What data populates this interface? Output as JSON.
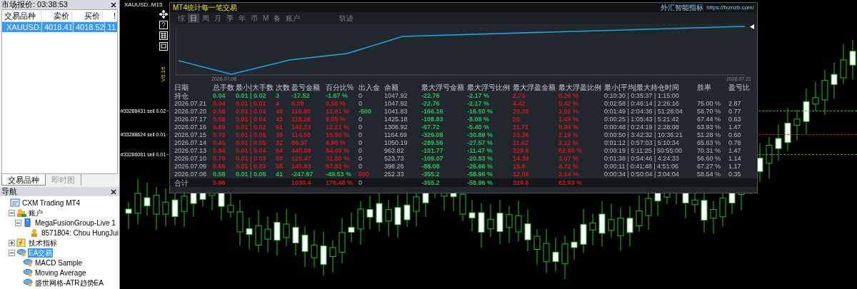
{
  "market_watch": {
    "title": "市场报价: 03:38:53",
    "columns": [
      "交易品种",
      "卖价",
      "买价",
      "!"
    ],
    "rows": [
      {
        "cells": [
          "XAUUSD.",
          "4018.41",
          "4018.52",
          "11"
        ],
        "selected": true
      }
    ],
    "tabs": [
      {
        "label": "交易品种",
        "selected": true
      },
      {
        "label": "即时图",
        "selected": false
      }
    ]
  },
  "navigator": {
    "title": "导航",
    "tree": [
      {
        "label": "CXM Trading MT4",
        "kind": "terminal",
        "selected": false,
        "children": [
          {
            "label": "账户",
            "kind": "accounts",
            "selected": false,
            "expanded": true,
            "children": [
              {
                "label": "MegaFusionGroup-Live 1",
                "kind": "server",
                "selected": false,
                "expanded": true,
                "children": [
                  {
                    "label": "8571804: Chou HungJui",
                    "kind": "account",
                    "selected": false
                  }
                ]
              }
            ]
          },
          {
            "label": "技术指标",
            "kind": "indicators",
            "selected": false,
            "expanded": false
          },
          {
            "label": "EA交易",
            "kind": "experts",
            "selected": true,
            "expanded": true,
            "children": [
              {
                "label": "MACD Sample",
                "kind": "expert",
                "selected": false
              },
              {
                "label": "Moving Average",
                "kind": "expert",
                "selected": false
              },
              {
                "label": "盛世网格-ATR趋势EA",
                "kind": "expert",
                "selected": false
              }
            ]
          }
        ]
      }
    ]
  },
  "chart": {
    "title": "XAUUSD..M15",
    "order_labels": [
      {
        "text": "#33288431 sell 0.02",
        "kind": "buy"
      },
      {
        "text": "#33288624 sell 0.01",
        "kind": "sell"
      },
      {
        "text": "#33286081 sell 0.01",
        "kind": "buy"
      }
    ]
  },
  "stats_panel": {
    "title": "MT4统计每一笔交易",
    "brand": "外汇智能指标",
    "url": "https://fxznzb.com/",
    "version": "V6.16",
    "tabs": [
      {
        "label": "综",
        "kind": "period",
        "selected": false
      },
      {
        "label": "日",
        "kind": "period",
        "selected": true
      },
      {
        "label": "周",
        "kind": "period",
        "selected": false
      },
      {
        "label": "月",
        "kind": "period",
        "selected": false
      },
      {
        "label": "季",
        "kind": "period",
        "selected": false
      },
      {
        "label": "年",
        "kind": "period",
        "selected": false
      },
      {
        "label": "币",
        "kind": "period",
        "selected": false
      },
      {
        "label": "M",
        "kind": "period",
        "selected": false
      },
      {
        "label": "备",
        "kind": "period",
        "selected": false
      },
      {
        "label": "账户",
        "kind": "period",
        "selected": false
      },
      {
        "label": "轨迹",
        "kind": "view",
        "selected": false
      }
    ],
    "curve": {
      "start_date": "2026.07.08",
      "end_date": "2026.07.21"
    },
    "columns": [
      "日期",
      "总手数",
      "最小|大手数",
      "次数",
      "盈亏金额",
      "百分比%",
      "出入金",
      "余额",
      "最大浮亏金额",
      "最大浮亏比例",
      "最大浮盈金额",
      "最大浮盈比例",
      "最小|平均|最大持仓时间",
      "胜率",
      "盈亏比"
    ],
    "rows": [
      {
        "kind": "open",
        "cells": [
          "持仓",
          {
            "text": "0.04",
            "color": "#1fc157"
          },
          {
            "text": "0.01 | 0.02",
            "color": "#1fc157"
          },
          {
            "text": "3",
            "color": "#1fc157"
          },
          {
            "text": "-17.52",
            "color": "#1fc157"
          },
          {
            "text": "-1.67 %",
            "color": "#1fc157"
          },
          "0",
          "1047.92",
          {
            "text": "-22.76",
            "color": "#1fc157"
          },
          {
            "text": "-2.17 %",
            "color": "#1fc157"
          },
          {
            "text": "2.73",
            "color": "#d0161e"
          },
          {
            "text": "0.26 %",
            "color": "#d0161e"
          },
          "0:10:30 | 0:35:37 | 1:15:00",
          null,
          null
        ]
      },
      {
        "kind": "day",
        "cells": [
          "2026.07.21",
          {
            "text": "0.04",
            "color": "#d0161e"
          },
          {
            "text": "0.01 | 0.01",
            "color": "#d0161e"
          },
          {
            "text": "4",
            "color": "#d0161e"
          },
          {
            "text": "6.09",
            "color": "#d0161e"
          },
          {
            "text": "0.58 %",
            "color": "#d0161e"
          },
          "0",
          "1047.92",
          {
            "text": "-22.76",
            "color": "#1fc157"
          },
          {
            "text": "-2.17 %",
            "color": "#1fc157"
          },
          {
            "text": "4.42",
            "color": "#d0161e"
          },
          {
            "text": "0.42 %",
            "color": "#d0161e"
          },
          "0:02:58 | 0:46:14 | 2:26:16",
          "75.00 %",
          "2.87"
        ]
      },
      {
        "kind": "day",
        "cells": [
          "2026.07.20",
          {
            "text": "0.66",
            "color": "#d0161e"
          },
          {
            "text": "0.01 | 0.04",
            "color": "#d0161e"
          },
          {
            "text": "46",
            "color": "#d0161e"
          },
          {
            "text": "116.65",
            "color": "#d0161e"
          },
          {
            "text": "12.61 %",
            "color": "#d0161e"
          },
          {
            "text": "-500",
            "color": "#1fc157"
          },
          "1041.83",
          {
            "text": "-166.16",
            "color": "#1fc157"
          },
          {
            "text": "-16.50 %",
            "color": "#1fc157"
          },
          {
            "text": "20.39",
            "color": "#d0161e"
          },
          {
            "text": "2.02 %",
            "color": "#d0161e"
          },
          "0:01:49 | 2:04:36 | 51:28:04",
          "58.70 %",
          "0.77"
        ]
      },
      {
        "kind": "day",
        "cells": [
          "2026.07.17",
          {
            "text": "0.58",
            "color": "#d0161e"
          },
          {
            "text": "0.01 | 0.04",
            "color": "#d0161e"
          },
          {
            "text": "43",
            "color": "#d0161e"
          },
          {
            "text": "118.26",
            "color": "#d0161e"
          },
          {
            "text": "9.05 %",
            "color": "#d0161e"
          },
          "0",
          "1425.18",
          {
            "text": "-108.83",
            "color": "#1fc157"
          },
          {
            "text": "-8.08 %",
            "color": "#1fc157"
          },
          {
            "text": "20",
            "color": "#d0161e"
          },
          {
            "text": "1.49 %",
            "color": "#d0161e"
          },
          "0:00:25 | 1:05:43 | 5:21:42",
          "67.44 %",
          "0.63"
        ]
      },
      {
        "kind": "day",
        "cells": [
          "2026.07.16",
          {
            "text": "0.69",
            "color": "#d0161e"
          },
          {
            "text": "0.01 | 0.02",
            "color": "#d0161e"
          },
          {
            "text": "61",
            "color": "#d0161e"
          },
          {
            "text": "142.23",
            "color": "#d0161e"
          },
          {
            "text": "12.21 %",
            "color": "#d0161e"
          },
          "0",
          "1306.92",
          {
            "text": "-67.72",
            "color": "#1fc157"
          },
          {
            "text": "-5.40 %",
            "color": "#1fc157"
          },
          {
            "text": "11.71",
            "color": "#d0161e"
          },
          {
            "text": "0.94 %",
            "color": "#d0161e"
          },
          "0:00:48 | 0:24:19 | 2:28:08",
          "63.93 %",
          "1.47"
        ]
      },
      {
        "kind": "day",
        "cells": [
          "2026.07.15",
          {
            "text": "0.73",
            "color": "#d0161e"
          },
          {
            "text": "0.01 | 0.05",
            "color": "#d0161e"
          },
          {
            "text": "39",
            "color": "#d0161e"
          },
          {
            "text": "114.50",
            "color": "#d0161e"
          },
          {
            "text": "10.90 %",
            "color": "#d0161e"
          },
          "0",
          "1164.69",
          {
            "text": "-329.08",
            "color": "#1fc157"
          },
          {
            "text": "-30.89 %",
            "color": "#1fc157"
          },
          {
            "text": "23.36",
            "color": "#d0161e"
          },
          {
            "text": "2.19 %",
            "color": "#d0161e"
          },
          "0:00:50 | 3:42:32 | 10:36:21",
          "51.28 %",
          "0.60"
        ]
      },
      {
        "kind": "day",
        "cells": [
          "2026.07.14",
          {
            "text": "0.45",
            "color": "#d0161e"
          },
          {
            "text": "0.01 | 0.05",
            "color": "#d0161e"
          },
          {
            "text": "32",
            "color": "#d0161e"
          },
          {
            "text": "86.37",
            "color": "#d0161e"
          },
          {
            "text": "8.96 %",
            "color": "#d0161e"
          },
          "0",
          "1050.19",
          {
            "text": "-289.56",
            "color": "#1fc157"
          },
          {
            "text": "-27.57 %",
            "color": "#1fc157"
          },
          {
            "text": "11.62",
            "color": "#d0161e"
          },
          {
            "text": "1.12 %",
            "color": "#d0161e"
          },
          "0:01:12 | 0:57:03 | 5:10:34",
          "65.63 %",
          "0.78"
        ]
      },
      {
        "kind": "day",
        "cells": [
          "2026.07.13",
          {
            "text": "0.84",
            "color": "#d0161e"
          },
          {
            "text": "0.01 | 0.04",
            "color": "#d0161e"
          },
          {
            "text": "64",
            "color": "#d0161e"
          },
          {
            "text": "440.09",
            "color": "#d0161e"
          },
          {
            "text": "84.03 %",
            "color": "#d0161e"
          },
          "0",
          "963.82",
          {
            "text": "-101.77",
            "color": "#1fc157"
          },
          {
            "text": "-11.47 %",
            "color": "#1fc157"
          },
          {
            "text": "329.6",
            "color": "#d0161e"
          },
          {
            "text": "62.93 %",
            "color": "#d0161e"
          },
          "0:00:19 | 5:11:25 | 50:55:00",
          "70.31 %",
          "1.47"
        ]
      },
      {
        "kind": "day",
        "cells": [
          "2026.07.10",
          {
            "text": "0.70",
            "color": "#d0161e"
          },
          {
            "text": "0.01 | 0.03",
            "color": "#d0161e"
          },
          {
            "text": "53",
            "color": "#d0161e"
          },
          {
            "text": "125.47",
            "color": "#d0161e"
          },
          {
            "text": "31.50 %",
            "color": "#d0161e"
          },
          "0",
          "523.73",
          {
            "text": "-109.07",
            "color": "#1fc157"
          },
          {
            "text": "-20.83 %",
            "color": "#1fc157"
          },
          {
            "text": "14.39",
            "color": "#d0161e"
          },
          {
            "text": "3.07 %",
            "color": "#d0161e"
          },
          "0:01:38 | 0:54:46 | 4:24:33",
          "56.60 %",
          "1.14"
        ]
      },
      {
        "kind": "day",
        "cells": [
          "2026.07.09",
          {
            "text": "0.65",
            "color": "#d0161e"
          },
          {
            "text": "0.01 | 0.03",
            "color": "#d0161e"
          },
          {
            "text": "55",
            "color": "#d0161e"
          },
          {
            "text": "145.93",
            "color": "#d0161e"
          },
          {
            "text": "57.83 %",
            "color": "#d0161e"
          },
          "0",
          "398.26",
          {
            "text": "-88.08",
            "color": "#1fc157"
          },
          {
            "text": "-26.66 %",
            "color": "#1fc157"
          },
          {
            "text": "15.6",
            "color": "#d0161e"
          },
          {
            "text": "4.72 %",
            "color": "#d0161e"
          },
          "0:00:11 | 0:41:48 | 4:51:06",
          "67.27 %",
          "1.17"
        ]
      },
      {
        "kind": "day",
        "cells": [
          "2026.07.08",
          {
            "text": "0.58",
            "color": "#1fc157"
          },
          {
            "text": "0.01 | 0.05",
            "color": "#1fc157"
          },
          {
            "text": "41",
            "color": "#1fc157"
          },
          {
            "text": "-247.67",
            "color": "#1fc157"
          },
          {
            "text": "-49.53 %",
            "color": "#1fc157"
          },
          {
            "text": "500",
            "color": "#d0161e"
          },
          "252.33",
          {
            "text": "-355.2",
            "color": "#1fc157"
          },
          {
            "text": "-58.96 %",
            "color": "#1fc157"
          },
          {
            "text": "12.09",
            "color": "#d0161e"
          },
          {
            "text": "2.14 %",
            "color": "#d0161e"
          },
          "0:00:34 | 0:50:04 | 3:04:04",
          "58.54 %",
          "0.35"
        ]
      },
      {
        "kind": "total",
        "cells": [
          "合计",
          {
            "text": "5.96",
            "color": "#d0161e"
          },
          null,
          null,
          {
            "text": "1030.4",
            "color": "#d0161e"
          },
          {
            "text": "176.48 %",
            "color": "#d0161e"
          },
          "0",
          null,
          {
            "text": "-355.2",
            "color": "#1fc157"
          },
          {
            "text": "-58.96 %",
            "color": "#1fc157"
          },
          {
            "text": "329.6",
            "color": "#d0161e"
          },
          {
            "text": "62.93 %",
            "color": "#d0161e"
          },
          null,
          null,
          null
        ]
      }
    ]
  }
}
